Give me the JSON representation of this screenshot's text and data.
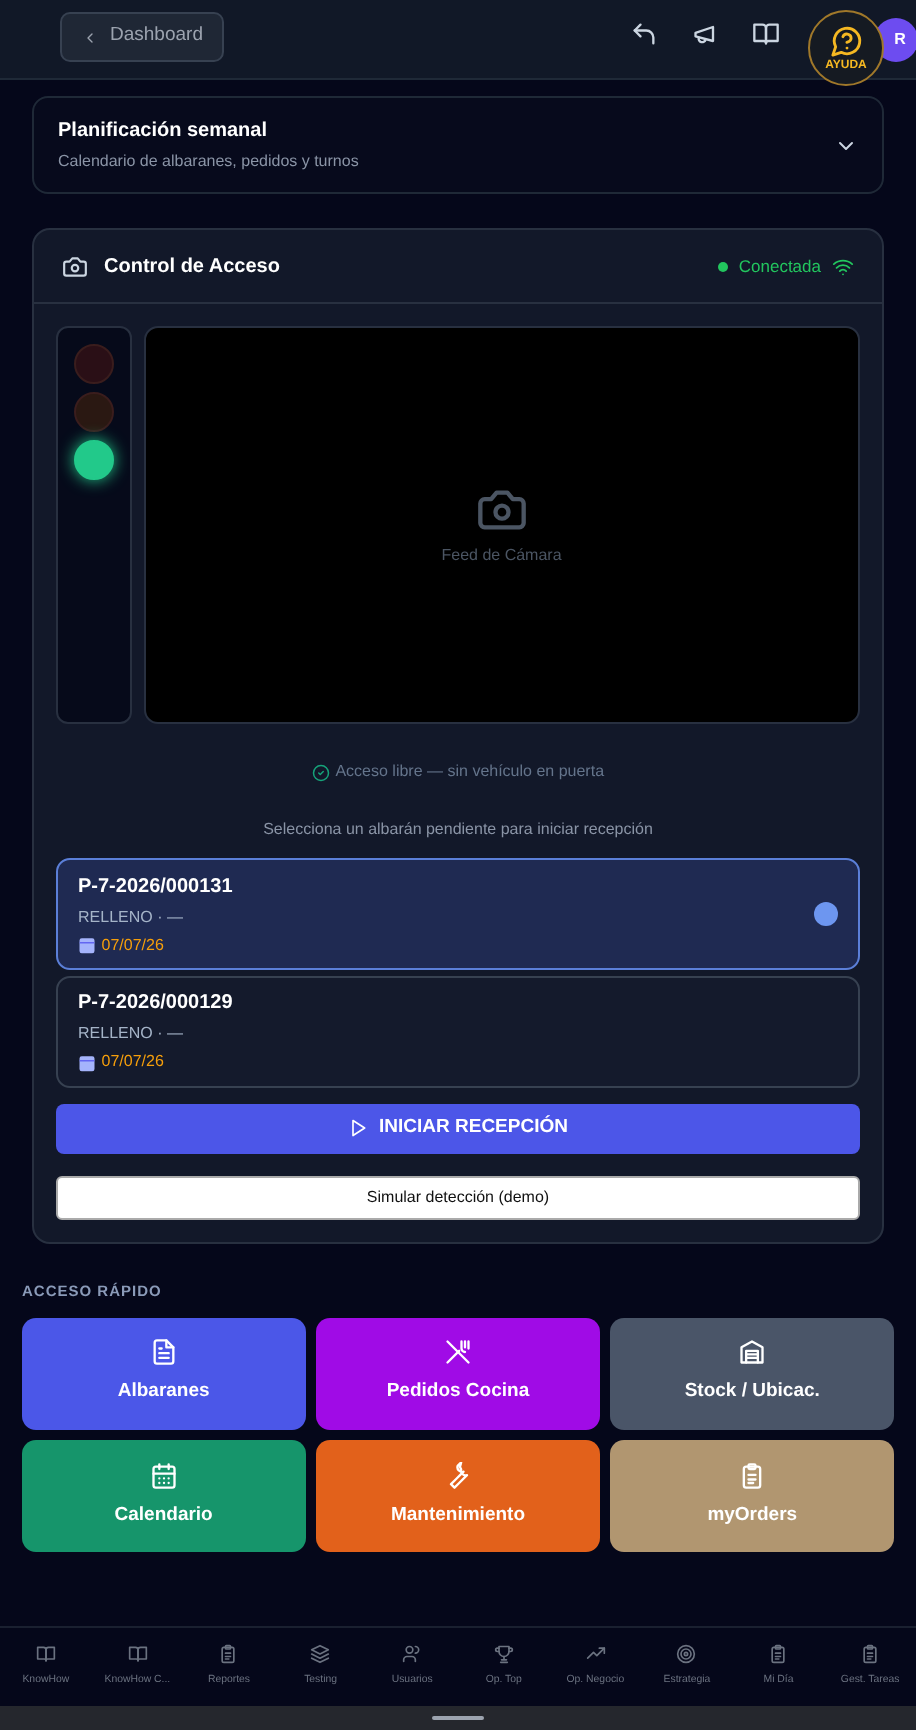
{
  "header": {
    "back_button": "Dashboard",
    "help_button": "AYUDA",
    "avatar": "R"
  },
  "planning": {
    "title": "Planificación semanal",
    "subtitle": "Calendario de albaranes, pedidos y turnos",
    "expanded": false
  },
  "access_control": {
    "title": "Control de Acceso",
    "connection": "Conectada",
    "traffic_light": [
      {
        "kind": "red",
        "on": false
      },
      {
        "kind": "amber",
        "on": false
      },
      {
        "kind": "green",
        "on": true
      }
    ],
    "camera_label": "Feed de Cámara",
    "status": "Acceso libre — sin vehículo en puerta",
    "prompt": "Selecciona un albarán pendiente para iniciar recepción",
    "delivery_notes": [
      {
        "number": "P-7-2026/000131",
        "detail": "RELLENO · —",
        "date": "07/07/26",
        "selected": true
      },
      {
        "number": "P-7-2026/000129",
        "detail": "RELLENO · —",
        "date": "07/07/26",
        "selected": false
      }
    ],
    "start_button": "INICIAR RECEPCIÓN",
    "simulate_button": "Simular detección (demo)"
  },
  "quick_access": {
    "title": "ACCESO RÁPIDO",
    "tiles": [
      {
        "label": "Albaranes",
        "color": "#4b57e8"
      },
      {
        "label": "Pedidos Cocina",
        "color": "#a00be6"
      },
      {
        "label": "Stock / Ubicac.",
        "color": "#4a5568"
      },
      {
        "label": "Calendario",
        "color": "#16956b"
      },
      {
        "label": "Mantenimiento",
        "color": "#e2611b"
      },
      {
        "label": "myOrders",
        "color": "#b19670"
      }
    ]
  },
  "bottom_nav": [
    "KnowHow",
    "KnowHow C...",
    "Reportes",
    "Testing",
    "Usuarios",
    "Op. Top",
    "Op. Negocio",
    "Estrategia",
    "Mi Día",
    "Gest. Tareas"
  ]
}
